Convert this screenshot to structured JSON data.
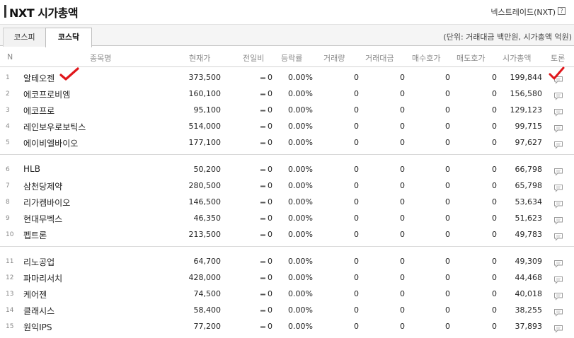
{
  "header": {
    "title": "NXT 시가총액",
    "source": "넥스트레이드(NXT)",
    "help_icon": "?"
  },
  "tabs": [
    {
      "label": "코스피",
      "active": false
    },
    {
      "label": "코스닥",
      "active": true
    }
  ],
  "unit_note": "(단위: 거래대금 백만원, 시가총액 억원)",
  "columns": [
    "N",
    "종목명",
    "현재가",
    "전일비",
    "등락률",
    "거래량",
    "거래대금",
    "매수호가",
    "매도호가",
    "시가총액",
    "토론"
  ],
  "rows": [
    {
      "no": "1",
      "name": "알테오젠",
      "price": "373,500",
      "change": "0",
      "rate": "0.00%",
      "volume": "0",
      "value": "0",
      "bid": "0",
      "ask": "0",
      "cap": "199,844"
    },
    {
      "no": "2",
      "name": "에코프로비엠",
      "price": "160,100",
      "change": "0",
      "rate": "0.00%",
      "volume": "0",
      "value": "0",
      "bid": "0",
      "ask": "0",
      "cap": "156,580"
    },
    {
      "no": "3",
      "name": "에코프로",
      "price": "95,100",
      "change": "0",
      "rate": "0.00%",
      "volume": "0",
      "value": "0",
      "bid": "0",
      "ask": "0",
      "cap": "129,123"
    },
    {
      "no": "4",
      "name": "레인보우로보틱스",
      "price": "514,000",
      "change": "0",
      "rate": "0.00%",
      "volume": "0",
      "value": "0",
      "bid": "0",
      "ask": "0",
      "cap": "99,715"
    },
    {
      "no": "5",
      "name": "에이비엘바이오",
      "price": "177,100",
      "change": "0",
      "rate": "0.00%",
      "volume": "0",
      "value": "0",
      "bid": "0",
      "ask": "0",
      "cap": "97,627"
    },
    {
      "no": "6",
      "name": "HLB",
      "price": "50,200",
      "change": "0",
      "rate": "0.00%",
      "volume": "0",
      "value": "0",
      "bid": "0",
      "ask": "0",
      "cap": "66,798"
    },
    {
      "no": "7",
      "name": "삼천당제약",
      "price": "280,500",
      "change": "0",
      "rate": "0.00%",
      "volume": "0",
      "value": "0",
      "bid": "0",
      "ask": "0",
      "cap": "65,798"
    },
    {
      "no": "8",
      "name": "리가켐바이오",
      "price": "146,500",
      "change": "0",
      "rate": "0.00%",
      "volume": "0",
      "value": "0",
      "bid": "0",
      "ask": "0",
      "cap": "53,634"
    },
    {
      "no": "9",
      "name": "현대무벡스",
      "price": "46,350",
      "change": "0",
      "rate": "0.00%",
      "volume": "0",
      "value": "0",
      "bid": "0",
      "ask": "0",
      "cap": "51,623"
    },
    {
      "no": "10",
      "name": "펩트론",
      "price": "213,500",
      "change": "0",
      "rate": "0.00%",
      "volume": "0",
      "value": "0",
      "bid": "0",
      "ask": "0",
      "cap": "49,783"
    },
    {
      "no": "11",
      "name": "리노공업",
      "price": "64,700",
      "change": "0",
      "rate": "0.00%",
      "volume": "0",
      "value": "0",
      "bid": "0",
      "ask": "0",
      "cap": "49,309"
    },
    {
      "no": "12",
      "name": "파마리서치",
      "price": "428,000",
      "change": "0",
      "rate": "0.00%",
      "volume": "0",
      "value": "0",
      "bid": "0",
      "ask": "0",
      "cap": "44,468"
    },
    {
      "no": "13",
      "name": "케어젠",
      "price": "74,500",
      "change": "0",
      "rate": "0.00%",
      "volume": "0",
      "value": "0",
      "bid": "0",
      "ask": "0",
      "cap": "40,018"
    },
    {
      "no": "14",
      "name": "클래시스",
      "price": "58,400",
      "change": "0",
      "rate": "0.00%",
      "volume": "0",
      "value": "0",
      "bid": "0",
      "ask": "0",
      "cap": "38,255"
    },
    {
      "no": "15",
      "name": "원익IPS",
      "price": "77,200",
      "change": "0",
      "rate": "0.00%",
      "volume": "0",
      "value": "0",
      "bid": "0",
      "ask": "0",
      "cap": "37,893"
    }
  ],
  "icons": {
    "talk": "speech-bubble-icon",
    "flat_change": "dash-icon",
    "annotation": "red-checkmark-icon"
  },
  "colors": {
    "annotation": "#e0161b",
    "header_text": "#8a8a8a",
    "divider": "#d9d9d9"
  }
}
